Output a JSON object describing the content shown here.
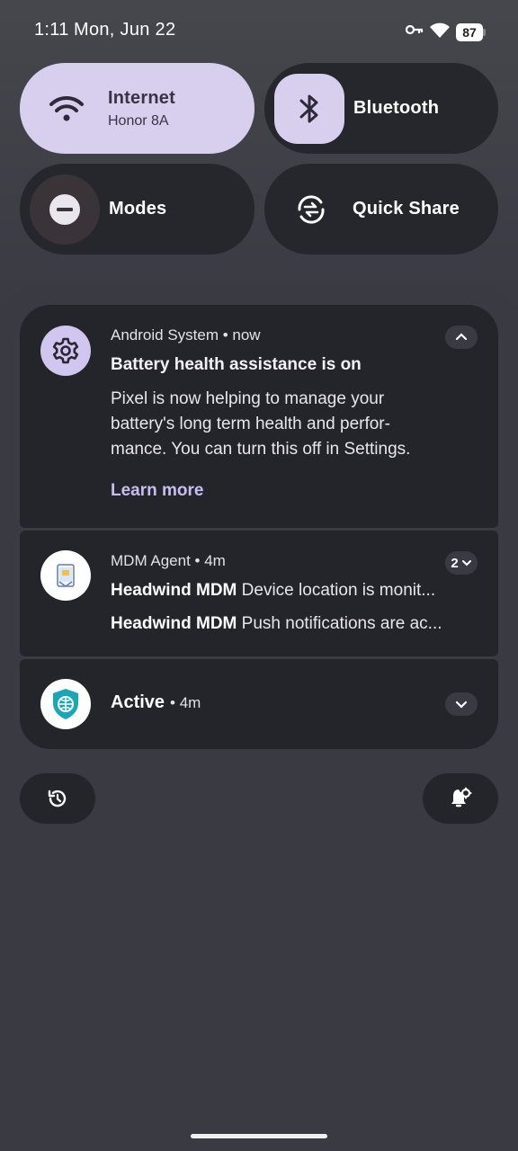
{
  "status_bar": {
    "time": "1:11",
    "date": "Mon, Jun 22",
    "battery_level": "87",
    "icons": [
      "vpn-key-icon",
      "wifi-icon",
      "battery-icon"
    ]
  },
  "quick_settings": {
    "internet": {
      "label": "Internet",
      "sub": "Honor 8A",
      "active": true,
      "icon": "wifi-icon"
    },
    "bluetooth": {
      "label": "Bluetooth",
      "active": false,
      "icon": "bluetooth-icon"
    },
    "modes": {
      "label": "Modes",
      "active": false,
      "icon": "do-not-disturb-icon"
    },
    "quick_share": {
      "label": "Quick Share",
      "active": false,
      "icon": "quick-share-icon"
    }
  },
  "notifications": [
    {
      "app": "Android System",
      "time": "now",
      "header": "Android System • now",
      "title": "Battery health assistance is on",
      "body": "Pixel is now helping to manage your battery's long term health and perfor­mance. You can turn this off in Settings.",
      "body_lines": [
        "Pixel is now helping to manage your",
        "battery's long term health and perfor-",
        "mance. You can turn this off in Settings."
      ],
      "action": "Learn more",
      "icon": "gear-icon"
    },
    {
      "app": "MDM Agent",
      "header": "MDM Agent • 4m",
      "count": "2",
      "lines": [
        {
          "title": "Headwind MDM",
          "text": "Device location is monit..."
        },
        {
          "title": "Headwind MDM",
          "text": "Push notifications are ac..."
        }
      ],
      "icon": "mdm-agent-icon"
    },
    {
      "app": "Active",
      "time_suffix": "• 4m",
      "icon": "shield-globe-icon"
    }
  ],
  "footer": {
    "history_icon": "history-icon",
    "settings_icon": "notification-settings-icon"
  },
  "colors": {
    "accent": "#d8cfef",
    "link": "#c9bdf0",
    "card": "#24252b",
    "shade": "#393a42"
  }
}
